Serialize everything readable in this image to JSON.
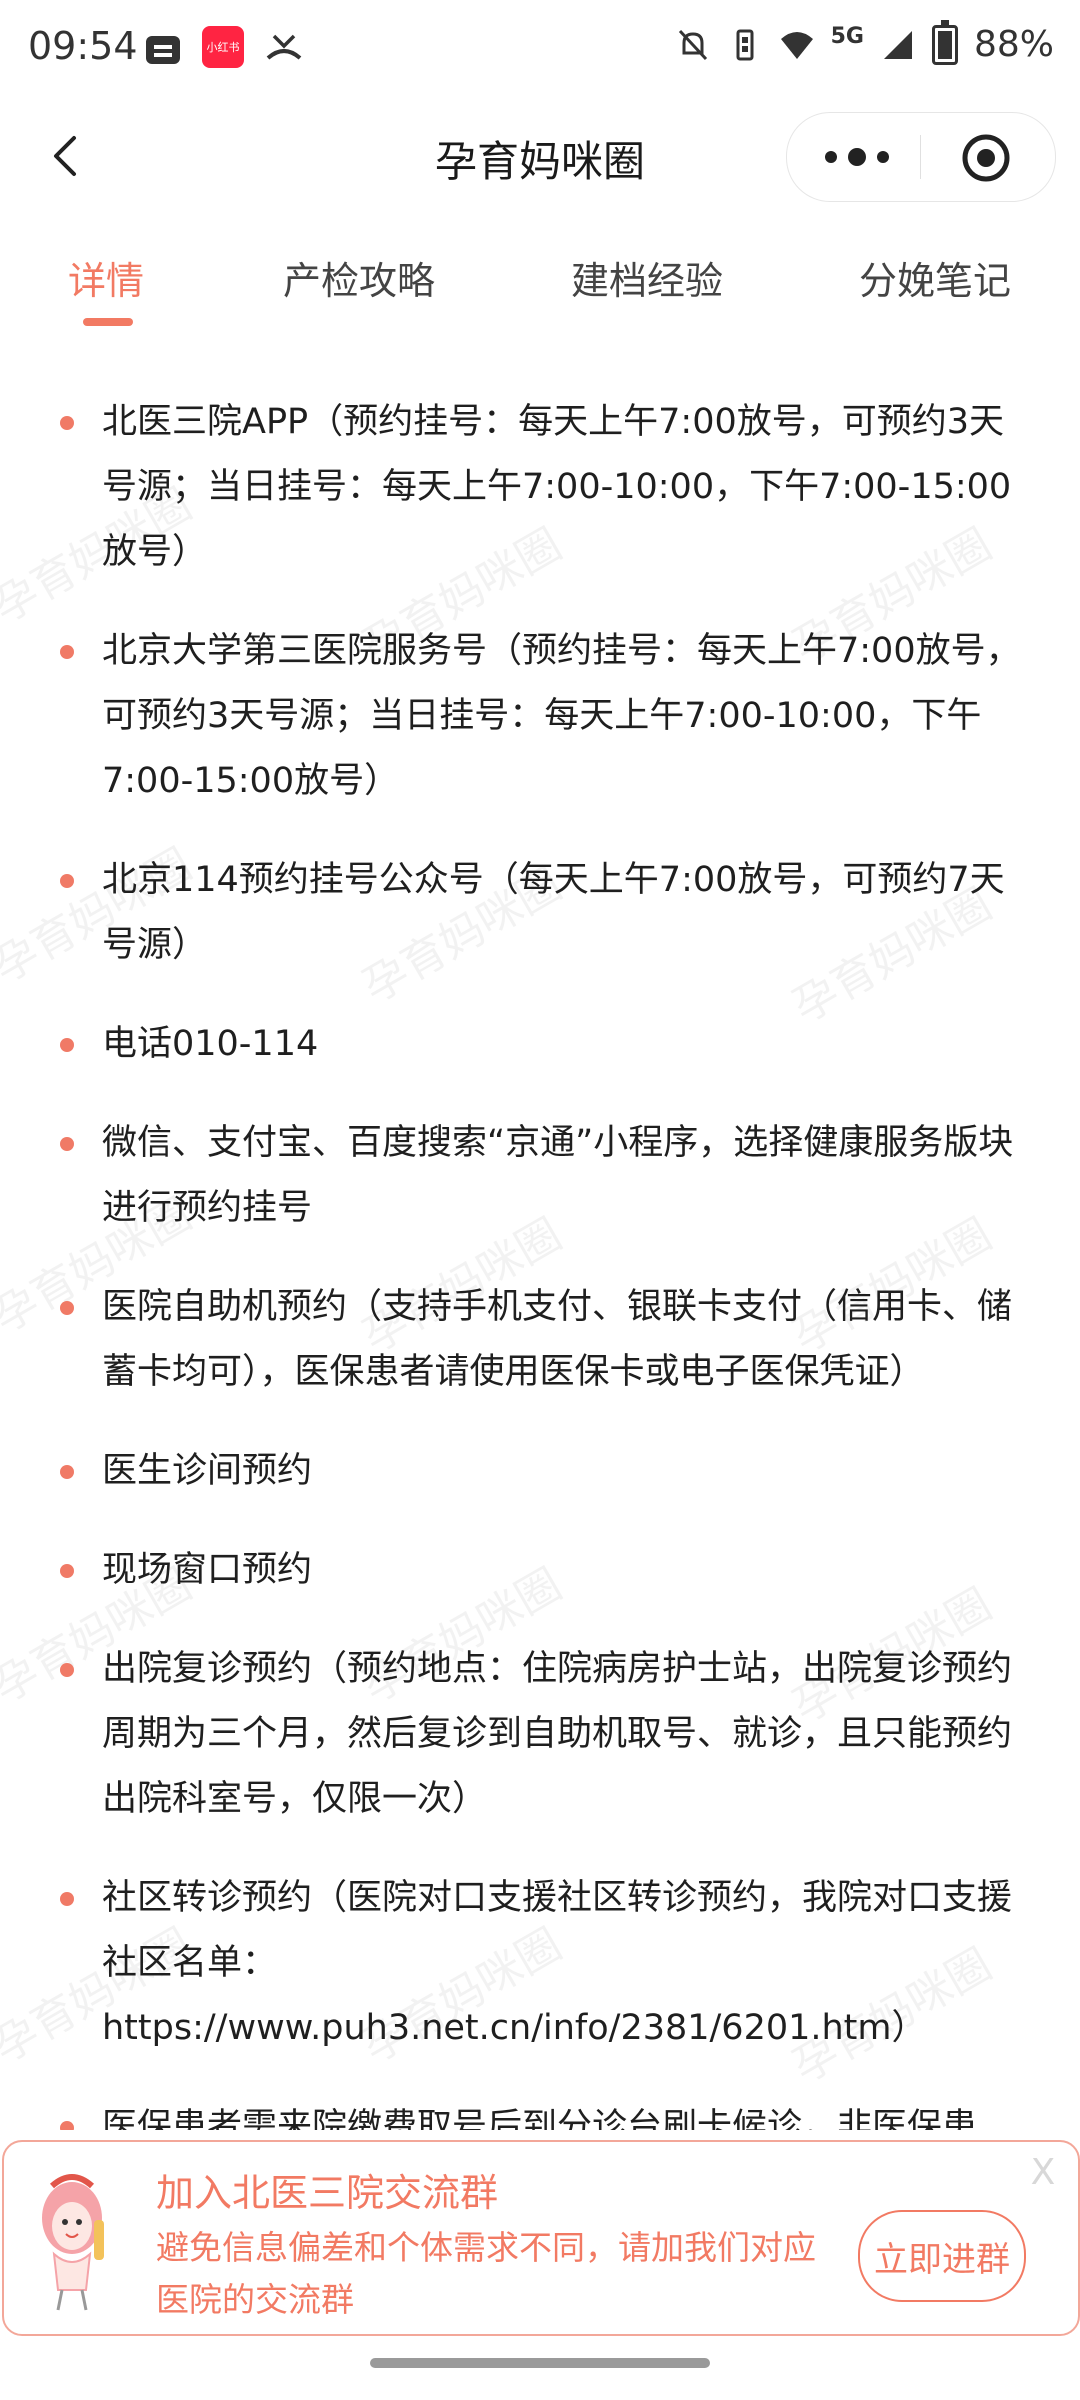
{
  "status_bar": {
    "time": "09:54",
    "xhs_label": "小红书",
    "network": "5G",
    "battery": "88%"
  },
  "navbar": {
    "title": "孕育妈咪圈"
  },
  "tabs": [
    {
      "label": "详情",
      "active": true
    },
    {
      "label": "产检攻略",
      "active": false
    },
    {
      "label": "建档经验",
      "active": false
    },
    {
      "label": "分娩笔记",
      "active": false
    }
  ],
  "content": {
    "items": [
      "北医三院APP（预约挂号：每天上午7:00放号，可预约3天号源；当日挂号：每天上午7:00-10:00，下午7:00-15:00放号）",
      "北京大学第三医院服务号（预约挂号：每天上午7:00放号，可预约3天号源；当日挂号：每天上午7:00-10:00，下午7:00-15:00放号）",
      "北京114预约挂号公众号（每天上午7:00放号，可预约7天号源）",
      "电话010-114",
      "微信、支付宝、百度搜索“京通”小程序，选择健康服务版块进行预约挂号",
      "医院自助机预约（支持手机支付、银联卡支付（信用卡、储蓄卡均可），医保患者请使用医保卡或电子医保凭证）",
      "医生诊间预约",
      "现场窗口预约",
      "出院复诊预约（预约地点：住院病房护士站，出院复诊预约周期为三个月，然后复诊到自助机取号、就诊，且只能预约出院科室号，仅限一次）",
      "社区转诊预约（医院对口支援社区转诊预约，我院对口支援社区名单：https://www.puh3.net.cn/info/2381/6201.htm）",
      "医保患者需来院缴费取号后到分诊台刷卡候诊，非医保患"
    ],
    "watermark": "孕育妈咪圈"
  },
  "banner": {
    "title": "加入北医三院交流群",
    "description": "避免信息偏差和个体需求不同，请加我们对应医院的交流群",
    "button_label": "立即进群",
    "close_label": "X"
  },
  "colors": {
    "accent": "#f27a63",
    "bullet": "#f07a66",
    "text": "#1f1f1f"
  }
}
